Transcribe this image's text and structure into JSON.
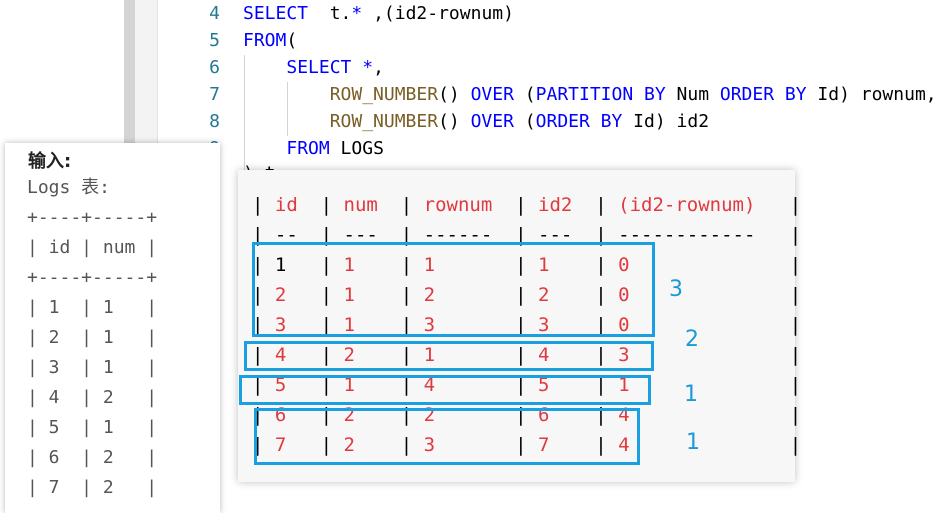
{
  "editor": {
    "lines": [
      {
        "num": "4",
        "tokens": [
          [
            "kw",
            "SELECT"
          ],
          [
            "op",
            "  t."
          ],
          [
            "kw",
            "*"
          ],
          [
            "op",
            " ,(id2-rownum)"
          ]
        ]
      },
      {
        "num": "5",
        "tokens": [
          [
            "kw",
            "FROM"
          ],
          [
            "op",
            "("
          ]
        ]
      },
      {
        "num": "6",
        "tokens": [
          [
            "op",
            "    "
          ],
          [
            "kw",
            "SELECT"
          ],
          [
            "op",
            " "
          ],
          [
            "kw",
            "*"
          ],
          [
            "op",
            ","
          ]
        ]
      },
      {
        "num": "7",
        "tokens": [
          [
            "op",
            "        "
          ],
          [
            "fn",
            "ROW_NUMBER"
          ],
          [
            "op",
            "() "
          ],
          [
            "kw",
            "OVER"
          ],
          [
            "op",
            " ("
          ],
          [
            "kw",
            "PARTITION BY"
          ],
          [
            "op",
            " Num "
          ],
          [
            "kw",
            "ORDER BY"
          ],
          [
            "op",
            " Id) rownum,"
          ]
        ]
      },
      {
        "num": "8",
        "tokens": [
          [
            "op",
            "        "
          ],
          [
            "fn",
            "ROW_NUMBER"
          ],
          [
            "op",
            "() "
          ],
          [
            "kw",
            "OVER"
          ],
          [
            "op",
            " ("
          ],
          [
            "kw",
            "ORDER BY"
          ],
          [
            "op",
            " Id) id2"
          ]
        ]
      },
      {
        "num": "9",
        "tokens": [
          [
            "op",
            "    "
          ],
          [
            "kw",
            "FROM"
          ],
          [
            "op",
            " LOGS"
          ]
        ]
      },
      {
        "num": "",
        "tokens": [
          [
            "op",
            ") t"
          ]
        ]
      }
    ]
  },
  "input_panel": {
    "title": "输入:",
    "lines": [
      "Logs 表:",
      "+----+-----+",
      "| id | num |",
      "+----+-----+",
      "| 1  | 1   |",
      "| 2  | 1   |",
      "| 3  | 1   |",
      "| 4  | 2   |",
      "| 5  | 1   |",
      "| 6  | 2   |",
      "| 7  | 2   |"
    ]
  },
  "result": {
    "header": [
      "id",
      "num",
      "rownum",
      "id2",
      "(id2-rownum)"
    ],
    "separator": [
      "--",
      "---",
      "------",
      "---",
      "------------"
    ],
    "rows": [
      [
        "1",
        "1",
        "1",
        "1",
        "0"
      ],
      [
        "2",
        "1",
        "2",
        "2",
        "0"
      ],
      [
        "3",
        "1",
        "3",
        "3",
        "0"
      ],
      [
        "4",
        "2",
        "1",
        "4",
        "3"
      ],
      [
        "5",
        "1",
        "4",
        "5",
        "1"
      ],
      [
        "6",
        "2",
        "2",
        "6",
        "4"
      ],
      [
        "7",
        "2",
        "3",
        "7",
        "4"
      ]
    ],
    "group_counts": [
      "3",
      "2",
      "1",
      "1"
    ],
    "highlight_color": "#1aa0e0",
    "text_color": "#e0393e"
  }
}
